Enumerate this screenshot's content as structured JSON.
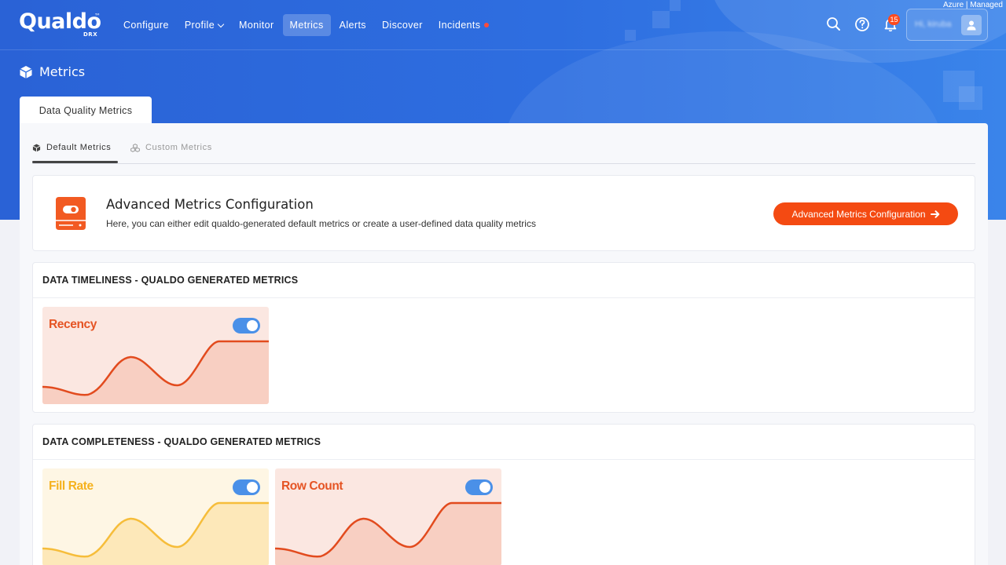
{
  "env_label": "Azure | Managed",
  "brand": {
    "name": "Qualdo",
    "tm": "™",
    "sub": "DRX"
  },
  "nav": [
    {
      "label": "Configure"
    },
    {
      "label": "Profile"
    },
    {
      "label": "Monitor"
    },
    {
      "label": "Metrics"
    },
    {
      "label": "Alerts"
    },
    {
      "label": "Discover"
    },
    {
      "label": "Incidents"
    }
  ],
  "nav_active": "Metrics",
  "notifications": {
    "count": "15"
  },
  "user": {
    "greeting": "Hi, kiruba"
  },
  "page": {
    "title": "Metrics"
  },
  "outer_tab": "Data Quality Metrics",
  "subtabs": [
    {
      "label": "Default Metrics",
      "active": true
    },
    {
      "label": "Custom Metrics",
      "active": false
    }
  ],
  "advanced": {
    "title": "Advanced Metrics Configuration",
    "description": "Here, you can either edit qualdo-generated default metrics or create a user-defined data quality metrics",
    "button_label": "Advanced Metrics Configuration"
  },
  "sections": [
    {
      "title": "DATA TIMELINESS - QUALDO GENERATED METRICS",
      "metrics": [
        {
          "name": "Recency",
          "enabled": true,
          "theme": "#e85a2a"
        }
      ]
    },
    {
      "title": "DATA COMPLETENESS - QUALDO GENERATED METRICS",
      "metrics": [
        {
          "name": "Fill Rate",
          "enabled": true,
          "theme": "#f5b62a"
        },
        {
          "name": "Row Count",
          "enabled": true,
          "theme": "#e85a2a"
        }
      ]
    }
  ],
  "colors": {
    "primary_blue": "#2e6ee0",
    "accent_orange": "#f44a12",
    "toggle_blue": "#4a90e8"
  }
}
